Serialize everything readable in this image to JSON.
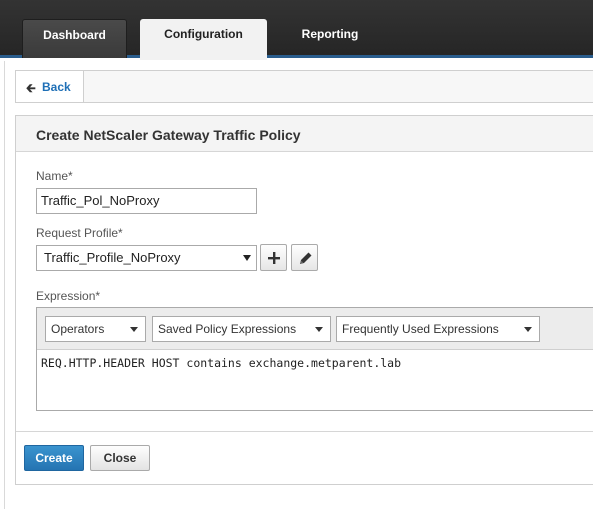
{
  "nav": {
    "tabs": [
      {
        "label": "Dashboard",
        "active": false
      },
      {
        "label": "Configuration",
        "active": true
      },
      {
        "label": "Reporting",
        "active": false
      }
    ]
  },
  "back": {
    "label": "Back",
    "icon": "arrow-left-icon"
  },
  "form": {
    "title": "Create NetScaler Gateway Traffic Policy",
    "name_label": "Name*",
    "name_value": "Traffic_Pol_NoProxy",
    "profile_label": "Request Profile*",
    "profile_value": "Traffic_Profile_NoProxy",
    "add_icon": "plus-icon",
    "edit_icon": "pencil-icon",
    "expression_label": "Expression*",
    "expression_dropdowns": [
      "Operators",
      "Saved Policy Expressions",
      "Frequently Used Expressions"
    ],
    "expression_value": "REQ.HTTP.HEADER HOST contains exchange.metparent.lab"
  },
  "actions": {
    "create_label": "Create",
    "close_label": "Close"
  },
  "colors": {
    "primary": "#2a7fc0",
    "link": "#1e6fb6",
    "topbar": "#2b2b2b"
  }
}
